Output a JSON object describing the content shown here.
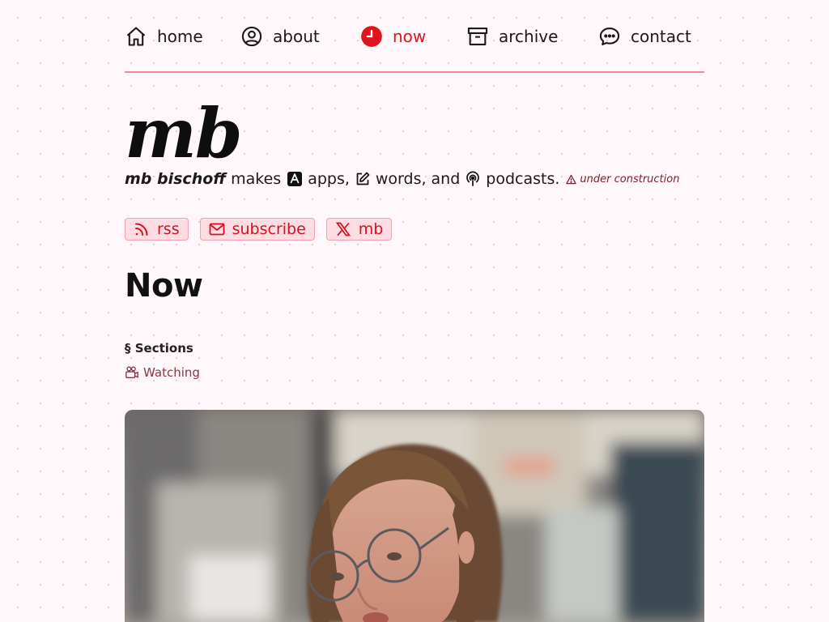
{
  "nav": {
    "items": [
      {
        "label": "home",
        "icon": "house-icon"
      },
      {
        "label": "about",
        "icon": "user-circle-icon"
      },
      {
        "label": "now",
        "icon": "clock-icon",
        "active": true
      },
      {
        "label": "archive",
        "icon": "archive-box-icon"
      },
      {
        "label": "contact",
        "icon": "chat-bubble-icon"
      }
    ]
  },
  "header": {
    "logo": "mb",
    "name": "mb bischoff",
    "makes": "makes",
    "apps": "apps,",
    "words": "words,",
    "and": "and",
    "podcasts": "podcasts.",
    "construction": "under construction"
  },
  "pills": [
    {
      "label": "rss",
      "icon": "rss-icon"
    },
    {
      "label": "subscribe",
      "icon": "envelope-icon"
    },
    {
      "label": "mb",
      "icon": "x-logo-icon"
    }
  ],
  "page": {
    "title": "Now",
    "sections_label": "§ Sections",
    "sections": [
      {
        "label": "Watching",
        "icon": "video-camera-icon"
      }
    ]
  },
  "colors": {
    "accent": "#e0141e",
    "background": "#fff7f9",
    "pill_bg": "#fddde2",
    "rule": "#ec8b9c"
  }
}
